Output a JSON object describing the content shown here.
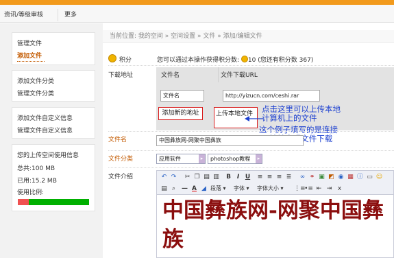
{
  "topnav": {
    "tab1": "资讯/等级审核",
    "tab2": "更多"
  },
  "sidebar": {
    "group1": [
      "管理文件",
      "添加文件"
    ],
    "group2": [
      "添加文件分类",
      "管理文件分类"
    ],
    "group3": [
      "添加文件自定义信息",
      "管理文件自定义信息"
    ],
    "usage": {
      "title": "您的上传空间使用信息",
      "total": "总共:100 MB",
      "used": "已用:15.2 MB",
      "ratio_label": "使用比例:",
      "used_fraction": 0.152
    }
  },
  "breadcrumb": "当前位置: 我的空间 » 空间设置 » 文件 » 添加/编辑文件",
  "points": {
    "label": "积分",
    "text": "您可以通过本操作获得积分数:",
    "value": "10",
    "suffix": "(您还有积分数 367)"
  },
  "download": {
    "label": "下载地址",
    "col_name": "文件名",
    "col_url": "文件下载URL",
    "name_value": "文件名",
    "url_value": "http://yizucn.com/ceshi.rar",
    "add_btn": "添加新的地址",
    "upload_btn": "上传本地文件"
  },
  "annotation": {
    "line1": "点击这里可以上传本地",
    "line2": "计算机上的文件",
    "line3": "这个例子填写的是连接",
    "line4": "url地址实现文件下载"
  },
  "filename": {
    "label": "文件名",
    "value": "中国彝族网-网聚中国彝族"
  },
  "category": {
    "label": "文件分类",
    "sel1": "应用软件",
    "sel2": "photoshop教程"
  },
  "intro": {
    "label": "文件介绍",
    "toolbar_para": "段落",
    "toolbar_font": "字体",
    "toolbar_size": "字体大小",
    "content": "中国彝族网-网聚中国彝族"
  }
}
